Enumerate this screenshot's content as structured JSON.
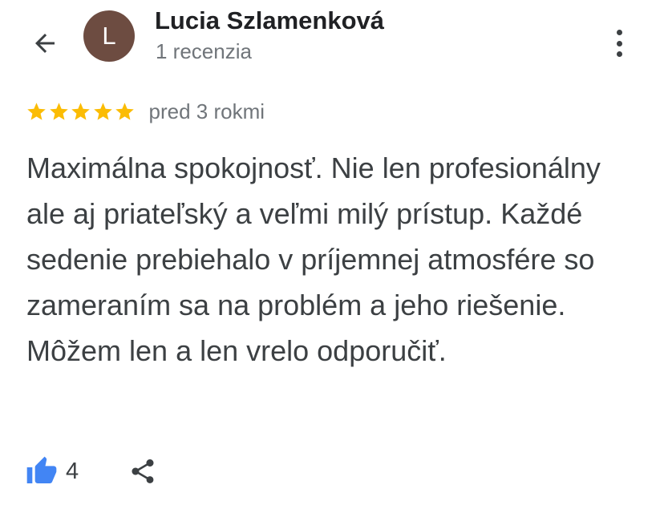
{
  "header": {
    "back_icon": "arrow-left-icon",
    "avatar_initial": "L",
    "avatar_color": "#6d4c41",
    "author_name": "Lucia Szlamenková",
    "author_meta": "1 recenzia",
    "more_icon": "more-vertical-icon"
  },
  "review": {
    "rating": 5,
    "rating_max": 5,
    "star_color": "#fbbc04",
    "time": "pred 3 rokmi",
    "text": "Maximálna spokojnosť. Nie len profesionálny ale aj priateľský a veľmi milý prístup. Každé sedenie prebiehalo v príjemnej atmosfére so zameraním sa na problém a jeho riešenie. Môžem len a len vrelo odporučiť."
  },
  "actions": {
    "like_icon": "thumb-up-icon",
    "like_color": "#4285f4",
    "like_count": "4",
    "share_icon": "share-icon"
  }
}
